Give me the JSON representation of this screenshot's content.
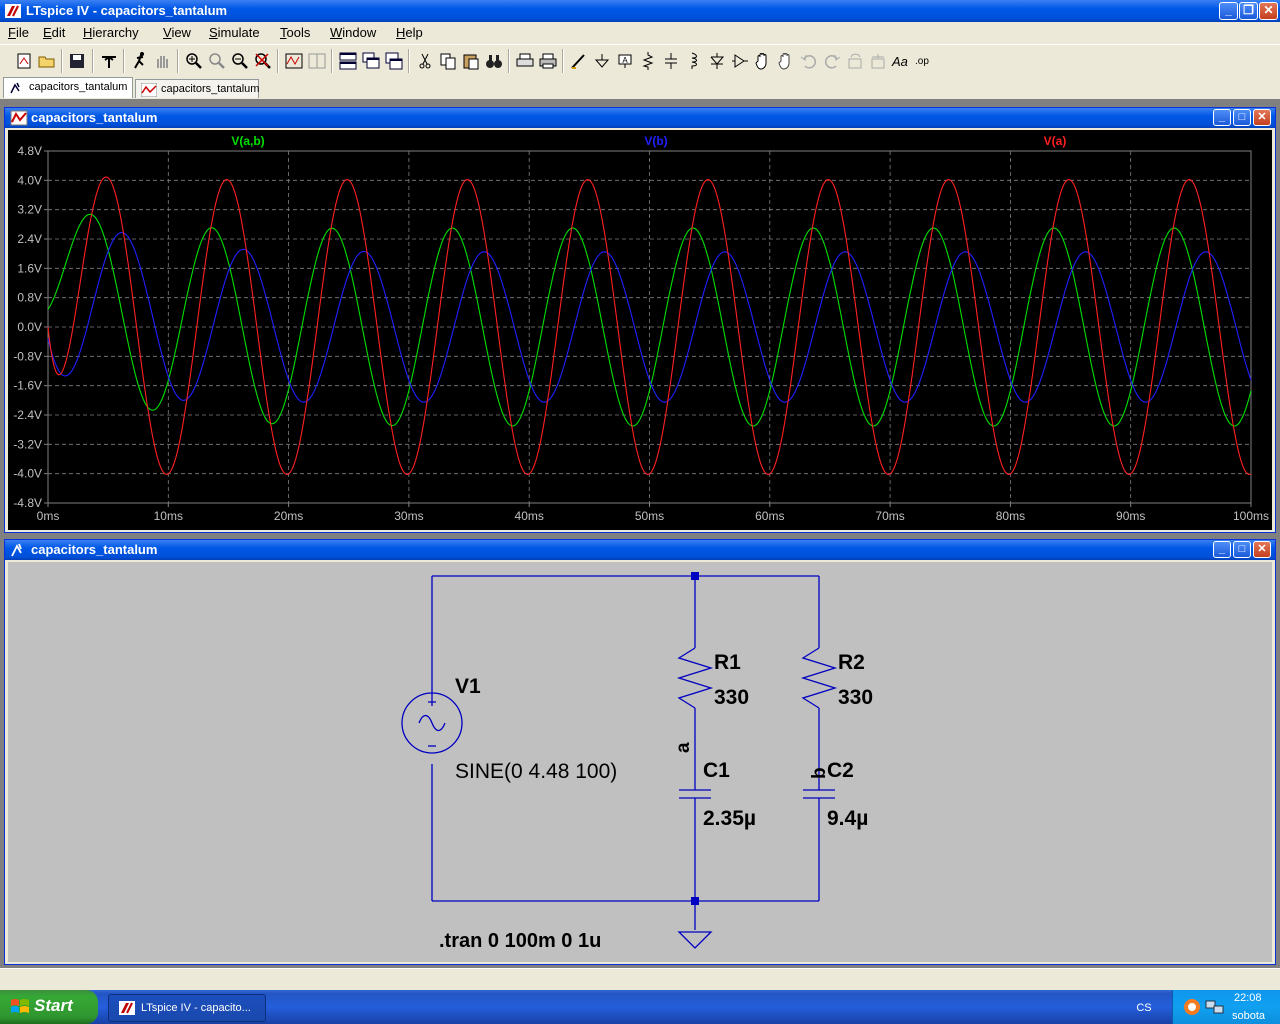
{
  "app": {
    "title": "LTspice IV - capacitors_tantalum"
  },
  "menu": [
    "File",
    "Edit",
    "Hierarchy",
    "View",
    "Simulate",
    "Tools",
    "Window",
    "Help"
  ],
  "toolbar": {
    "icons": [
      "new-schematic-icon",
      "open-icon",
      "save-icon",
      "control-panel-icon",
      "run-icon",
      "halt-icon",
      "zoom-in-icon",
      "zoom-pan-icon",
      "zoom-out-icon",
      "zoom-cancel-icon",
      "autorange-icon",
      "cursor-icon",
      "tile-vertical-icon",
      "cascade-icon",
      "tile-horizontal-icon",
      "cut-icon",
      "copy-icon",
      "paste-icon",
      "find-icon",
      "print-setup-icon",
      "print-icon",
      "wire-icon",
      "ground-icon",
      "label-net-icon",
      "resistor-icon",
      "capacitor-icon",
      "inductor-icon",
      "diode-icon",
      "component-icon",
      "move-icon",
      "drag-icon",
      "undo-icon",
      "redo-icon",
      "rotate-icon",
      "mirror-icon",
      "text-icon",
      "spice-directive-icon"
    ]
  },
  "tabs": [
    {
      "label": "capacitors_tantalum",
      "kind": "schematic",
      "active": true
    },
    {
      "label": "capacitors_tantalum",
      "kind": "waveform",
      "active": false
    }
  ],
  "plot_window": {
    "title": "capacitors_tantalum"
  },
  "schematic_window": {
    "title": "capacitors_tantalum"
  },
  "chart_data": {
    "type": "line",
    "title": "",
    "xlabel": "",
    "ylabel": "",
    "xlim": [
      0,
      100
    ],
    "ylim": [
      -4.8,
      4.8
    ],
    "x_unit": "ms",
    "y_unit": "V",
    "x_ticks": [
      "0ms",
      "10ms",
      "20ms",
      "30ms",
      "40ms",
      "50ms",
      "60ms",
      "70ms",
      "80ms",
      "90ms",
      "100ms"
    ],
    "y_ticks": [
      "4.8V",
      "4.0V",
      "3.2V",
      "2.4V",
      "1.6V",
      "0.8V",
      "0.0V",
      "-0.8V",
      "-1.6V",
      "-2.4V",
      "-3.2V",
      "-4.0V",
      "-4.8V"
    ],
    "grid": true,
    "legend_placement": "top",
    "background": "#000000",
    "series": [
      {
        "name": "V(a,b)",
        "color": "#00e000",
        "amplitude": 2.7,
        "frequency_hz": 100,
        "phase_deg": -40,
        "steady_start_ms": 12,
        "first_peak": 1.95
      },
      {
        "name": "V(b)",
        "color": "#2020ff",
        "amplitude": 2.05,
        "frequency_hz": 100,
        "phase_deg": -135,
        "steady_start_ms": 12,
        "first_peak": 2.5
      },
      {
        "name": "V(a)",
        "color": "#ff2020",
        "amplitude": 4.02,
        "frequency_hz": 100,
        "phase_deg": -85,
        "steady_start_ms": 0,
        "first_peak": 4.02
      }
    ]
  },
  "schematic": {
    "components": [
      {
        "ref": "V1",
        "value": "SINE(0 4.48 100)"
      },
      {
        "ref": "R1",
        "value": "330"
      },
      {
        "ref": "R2",
        "value": "330"
      },
      {
        "ref": "C1",
        "value": "2.35µ"
      },
      {
        "ref": "C2",
        "value": "9.4µ"
      }
    ],
    "net_labels": [
      "a",
      "b"
    ],
    "directive": ".tran 0 100m 0 1u",
    "wire_color": "#0000c0",
    "background": "#c0c0c0"
  },
  "taskbar": {
    "start_label": "Start",
    "task_label": "LTspice IV - capacito...",
    "language": "CS",
    "time": "22:08",
    "day": "sobota"
  }
}
